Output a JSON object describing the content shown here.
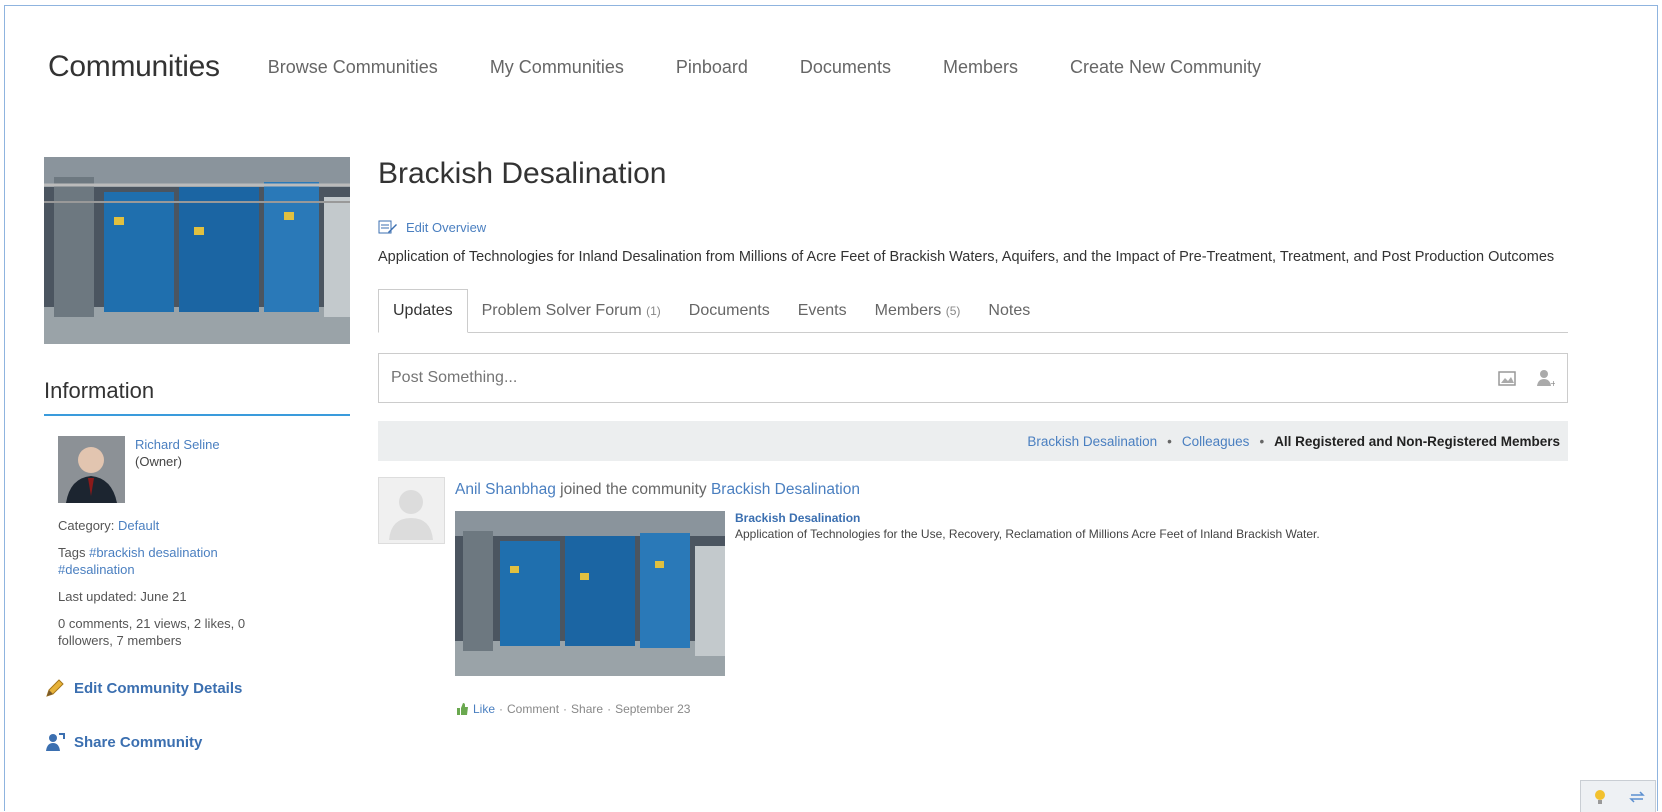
{
  "nav": {
    "brand": "Communities",
    "links": [
      "Browse Communities",
      "My Communities",
      "Pinboard",
      "Documents",
      "Members",
      "Create New Community"
    ]
  },
  "sidebar": {
    "info_heading": "Information",
    "owner_name": "Richard Seline",
    "owner_role": "(Owner)",
    "category_label": "Category:",
    "category_value": "Default",
    "tags_label": "Tags",
    "tag_1": "#brackish desalination",
    "tag_2": "#desalination",
    "last_updated": "Last updated: June 21",
    "stats": "0 comments, 21 views, 2 likes, 0 followers, 7 members",
    "edit_details": "Edit Community Details",
    "share": "Share Community"
  },
  "main": {
    "title": "Brackish Desalination",
    "edit_overview": "Edit Overview",
    "description": "Application of Technologies for Inland Desalination from Millions of Acre Feet of Brackish Waters, Aquifers, and the Impact of Pre-Treatment, Treatment, and Post Production Outcomes",
    "tabs": [
      {
        "label": "Updates",
        "count": ""
      },
      {
        "label": "Problem Solver Forum",
        "count": "(1)"
      },
      {
        "label": "Documents",
        "count": ""
      },
      {
        "label": "Events",
        "count": ""
      },
      {
        "label": "Members",
        "count": "(5)"
      },
      {
        "label": "Notes",
        "count": ""
      }
    ],
    "post_placeholder": "Post Something...",
    "filter": {
      "link_1": "Brackish Desalination",
      "link_2": "Colleagues",
      "active": "All Registered and Non-Registered Members",
      "sep": "•"
    },
    "activity": {
      "actor": "Anil Shanbhag",
      "action": "joined the community",
      "target": "Brackish Desalination",
      "shared_title": "Brackish Desalination",
      "shared_desc": "Application of Technologies for the Use, Recovery, Reclamation of Millions Acre Feet of Inland Brackish Water.",
      "like": "Like",
      "comment": "Comment",
      "share": "Share",
      "date": "September 23",
      "dot": "·"
    }
  },
  "colors": {
    "accent": "#3a9bdc",
    "link": "#4a7fc0"
  }
}
